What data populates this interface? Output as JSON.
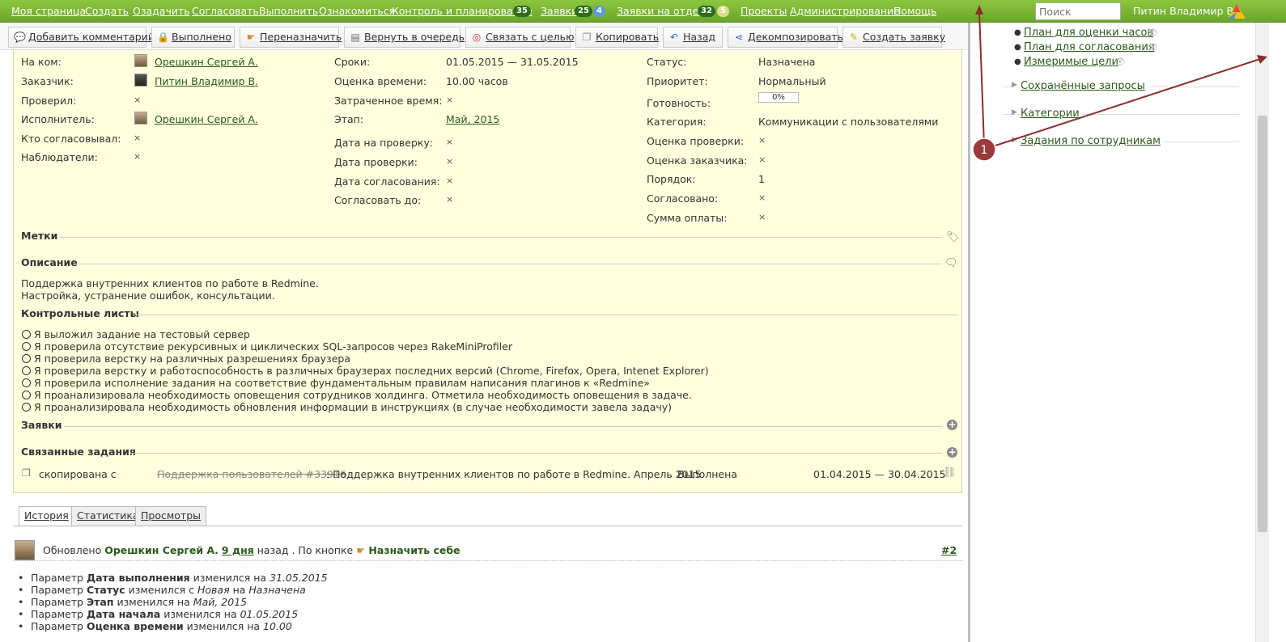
{
  "topmenu": [
    {
      "label": "Моя страница"
    },
    {
      "label": "Создать"
    },
    {
      "label": "Озадачить"
    },
    {
      "label": "Согласовать"
    },
    {
      "label": "Выполнить"
    },
    {
      "label": "Ознакомиться"
    },
    {
      "label": "Контроль и планирование"
    },
    {
      "label": "Заявки"
    },
    {
      "label": "Заявки на отделе"
    },
    {
      "label": "Проекты"
    },
    {
      "label": "Администрирование"
    },
    {
      "label": "Помощь"
    }
  ],
  "badges": {
    "control": "35",
    "requests": "25",
    "requests_extra": "4",
    "dept": "32",
    "dept_extra": "5"
  },
  "search": {
    "placeholder": "Поиск"
  },
  "user": "Питин Владимир В.",
  "toolbar": [
    "Добавить комментарий",
    "Выполнено",
    "Переназначить",
    "Вернуть в очередь",
    "Связать с целью",
    "Копировать",
    "Назад",
    "Декомпозировать",
    "Создать заявку"
  ],
  "attrs": {
    "left": [
      {
        "label": "На ком:",
        "value": "Орешкин Сергей А."
      },
      {
        "label": "Заказчик:",
        "value": "Питин Владимир В."
      },
      {
        "label": "Проверил:",
        "value": "×"
      },
      {
        "label": "Исполнитель:",
        "value": "Орешкин Сергей А."
      },
      {
        "label": "Кто согласовывал:",
        "value": "×"
      },
      {
        "label": "Наблюдатели:",
        "value": "×"
      }
    ],
    "mid": [
      {
        "label": "Сроки:",
        "value": "01.05.2015 — 31.05.2015"
      },
      {
        "label": "Оценка времени:",
        "value": "10.00 часов"
      },
      {
        "label": "Затраченное время:",
        "value": "×"
      },
      {
        "label": "Этап:",
        "value": "Май, 2015"
      },
      {
        "label": "Дата на проверку:",
        "value": "×"
      },
      {
        "label": "Дата проверки:",
        "value": "×"
      },
      {
        "label": "Дата согласования:",
        "value": "×"
      },
      {
        "label": "Согласовать до:",
        "value": "×"
      }
    ],
    "right": [
      {
        "label": "Статус:",
        "value": "Назначена"
      },
      {
        "label": "Приоритет:",
        "value": "Нормальный"
      },
      {
        "label": "Готовность:",
        "value": "0%"
      },
      {
        "label": "Категория:",
        "value": "Коммуникации с пользователями"
      },
      {
        "label": "Оценка проверки:",
        "value": "×"
      },
      {
        "label": "Оценка заказчика:",
        "value": "×"
      },
      {
        "label": "Порядок:",
        "value": "1"
      },
      {
        "label": "Согласовано:",
        "value": "×"
      },
      {
        "label": "Сумма оплаты:",
        "value": "×"
      }
    ]
  },
  "progress": 0,
  "sections": {
    "tags": "Метки",
    "desc": "Описание",
    "checklists": "Контрольные листы",
    "requests": "Заявки",
    "related": "Связанные задания"
  },
  "description": [
    "Поддержка внутренних клиентов по работе в Redmine.",
    "Настройка, устранение ошибок, консультации."
  ],
  "checklist": [
    "Я выложил задание на тестовый сервер",
    "Я проверила отсутствие рекурсивных и циклических SQL-запросов через RakeMiniProfiler",
    "Я проверила верстку на различных разрешениях браузера",
    "Я проверила верстку и работоспособность в различных браузерах последних версий (Chrome, Firefox, Opera, Intenet Explorer)",
    "Я проверила исполнение задания на соответствие фундаментальным правилам написания плагинов к «Redmine»",
    "Я проанализировала необходимость оповещения сотрудников холдинга. Отметила необходимость оповещения в задаче.",
    "Я проанализировала необходимость обновления информации в инструкциях (в случае необходимости завела задачу)"
  ],
  "related": {
    "relation": "скопирована с",
    "link": "Поддержка пользователей #33916",
    "subject": ": Поддержка внутренних клиентов по работе в Redmine. Апрель 2015",
    "status": "Выполнена",
    "dates": "01.04.2015 — 30.04.2015"
  },
  "tabs": [
    "История",
    "Статистика",
    "Просмотры"
  ],
  "journal": {
    "prefix": "Обновлено",
    "user": "Орешкин Сергей А.",
    "ago": "9 дня",
    "suffix": "назад . По кнопке",
    "action": "Назначить себе",
    "num": "#2"
  },
  "history": [
    {
      "p": "Параметр ",
      "f": "Дата выполнения",
      "m": " изменился на ",
      "v": "31.05.2015"
    },
    {
      "p": "Параметр ",
      "f": "Статус",
      "m": " изменился с ",
      "v": "Новая",
      "m2": " на ",
      "v2": "Назначена"
    },
    {
      "p": "Параметр ",
      "f": "Этап",
      "m": " изменился на ",
      "v": "Май, 2015"
    },
    {
      "p": "Параметр ",
      "f": "Дата начала",
      "m": " изменился на ",
      "v": "01.05.2015"
    },
    {
      "p": "Параметр ",
      "f": "Оценка времени",
      "m": " изменился на ",
      "v": "10.00"
    }
  ],
  "sidebar": {
    "links": [
      "План для оценки часов",
      "План для согласования",
      "Измеримые цели"
    ],
    "groups": [
      "Сохранённые запросы",
      "Категории",
      "Задания по сотрудникам"
    ]
  },
  "callout": "1"
}
